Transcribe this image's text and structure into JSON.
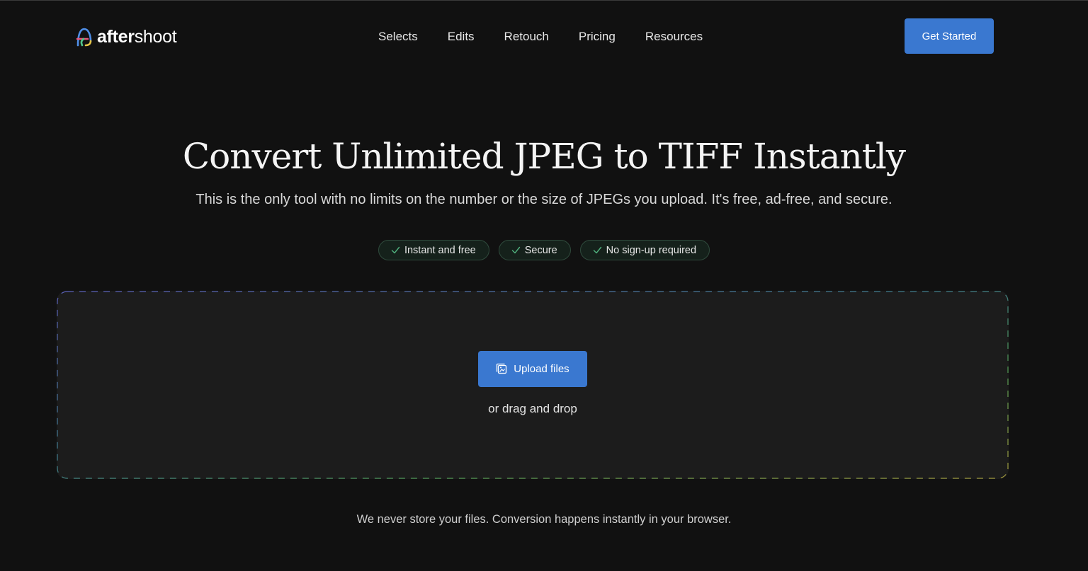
{
  "header": {
    "logo": {
      "prefix": "after",
      "suffix": "shoot",
      "icon": "aftershoot-logo-icon"
    },
    "nav": [
      {
        "label": "Selects"
      },
      {
        "label": "Edits"
      },
      {
        "label": "Retouch"
      },
      {
        "label": "Pricing"
      },
      {
        "label": "Resources"
      }
    ],
    "cta_label": "Get Started",
    "cta_color": "#3a78d0"
  },
  "hero": {
    "title": "Convert Unlimited JPEG to TIFF Instantly",
    "subtitle": "This is the only tool with no limits on the number or the size of JPEGs you upload. It's free, ad-free, and secure."
  },
  "badges": [
    {
      "label": "Instant and free",
      "icon": "check-icon"
    },
    {
      "label": "Secure",
      "icon": "check-icon"
    },
    {
      "label": "No sign-up required",
      "icon": "check-icon"
    }
  ],
  "dropzone": {
    "upload_label": "Upload files",
    "upload_icon": "upload-image-icon",
    "drag_text": "or drag and drop"
  },
  "footer_note": "We never store your files. Conversion happens instantly in your browser."
}
